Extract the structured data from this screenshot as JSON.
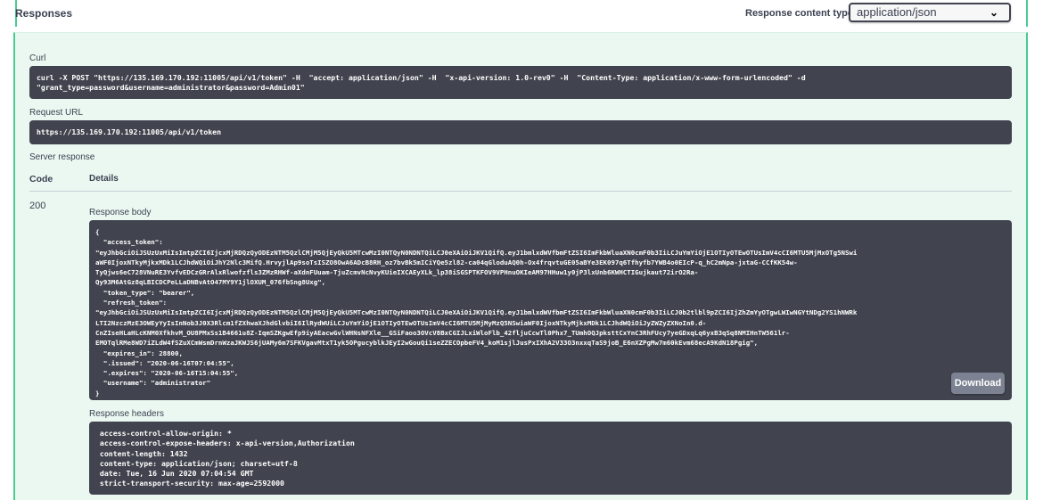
{
  "header": {
    "title": "Responses",
    "content_type_label": "Response content type",
    "content_type_value": "application/json"
  },
  "curl": {
    "label": "Curl",
    "command": "curl -X POST \"https://135.169.170.192:11005/api/v1/token\" -H  \"accept: application/json\" -H  \"x-api-version: 1.0-rev0\" -H  \"Content-Type: application/x-www-form-urlencoded\" -d\n\"grant_type=password&username=administrator&password=Admin01\""
  },
  "request_url": {
    "label": "Request URL",
    "value": "https://135.169.170.192:11005/api/v1/token"
  },
  "server_response": {
    "label": "Server response",
    "col_code": "Code",
    "col_details": "Details",
    "code": "200",
    "body_label": "Response body",
    "body": "{\n  \"access_token\":\n\"eyJhbGciOiJSUzUxMiIsImtpZCI6IjcxMjRDQzQyODEzNTM5QzlCMjM5QjEyQkU5MTcwMzI0NTQyN0NDNTQiLCJ0eXAiOiJKV1QifQ.eyJ1bmlxdWVfbmFtZSI6ImFkbWluaXN0cmF0b3IiLCJuYmYiOjE1OTIyOTEwOTUsImV4cCI6MTU5MjMxOTg5NSwi\naWF0IjoxNTkyMjkxMDk1LCJhdWQiOiJhY2Nlc3MifQ.HrvyjlAp9soTsISZO8OwA6ADcB8RH_oz7bvBk5mICiYQe5zl82-ca04qGloduAQ0h-Ox4frqvtuGE05aBYe3EK097q6Tfhyfb7YWB4o0EIcP-q_hC2mNpa-jxtaG-CCfKK54w-\nTyQjws6eC728VNuRE3YvfvEDCzGRrAlxRlwofzfls3ZMzRHWf-aXdnFUuam-TjuZcmvNcNvyKUieIXCAEyXLk_lp38iSGSPTKFOV9VPHnuOKIeAM97HHuw1y0jP3lxUnb6KWHCTIGujkaut72irO2Ra-\nQy93M6AtGz8qLBICDCPeLLaDNBvAtO47MY9Y1jlOXUM_076fbSng8Uxg\",\n  \"token_type\": \"bearer\",\n  \"refresh_token\":\n\"eyJhbGciOiJSUzUxMiIsImtpZCI6IjcxMjRDQzQyODEzNTM5QzlCMjM5QjEyQkU5MTcwMzI0NTQyN0NDNTQiLCJ0eXAiOiJKV1QifQ.eyJ1bmlxdWVfbmFtZSI6ImFkbWluaXN0cmF0b3IiLCJ0b2tlbl9pZCI6IjZhZmYyOTgwLWIwNGYtNDg2YS1hNWRk\nLTI2NzczMzE3OWEyYyIsInNob3J0X3Rlcm1fZXhwaXJhdGlvbiI6IlRydWUiLCJuYmYiOjE1OTIyOTEwOTUsImV4cCI6MTU5MjMyMzQ5NSwiaWF0IjoxNTkyMjkxMDk1LCJhdWQiOiJyZWZyZXNoIn0.d-\nCnZIseHLaHLcKNM0XfkhvM_OU8PMxSs1B4661u8Z-IqmSZKgwEfp9iyAEacwGvlWHNsNFXle__GSiFaoo3OVcV8BxCGIJLxiWloFlb_42fljuCcwTl0Phx7_TUmhOQJpksttCxYnC3RhFUcy7yeGDxqLq6yxB3qSq8NMIHnTW561lr-\nEMOTqlRMe8WD7iZLdW4fSZuXCmWsmDrnWzaJKWJS6jUAMy6m7SFKVgavMtxT1yk5OPgucyblkJEyI2wGouQi1seZZECOpbeFV4_koM1sjlJusPxIXhA2V33O3nxxqTaS9joB_E6nXZPgMw7m60kEvm68ecA9KdN18Pgig\",\n  \"expires_in\": 28800,\n  \".issued\": \"2020-06-16T07:04:55\",\n  \".expires\": \"2020-06-16T15:04:55\",\n  \"username\": \"administrator\"\n}",
    "download_label": "Download",
    "headers_label": "Response headers",
    "headers": " access-control-allow-origin: * \n access-control-expose-headers: x-api-version,Authorization \n content-length: 1432 \n content-type: application/json; charset=utf-8 \n date: Tue, 16 Jun 2020 07:04:54 GMT \n strict-transport-security: max-age=2592000 "
  },
  "colors": {
    "accent": "#49cc90",
    "panel_bg": "#ebf8f1",
    "code_bg": "#41444e",
    "button_bg": "#7d8293"
  }
}
